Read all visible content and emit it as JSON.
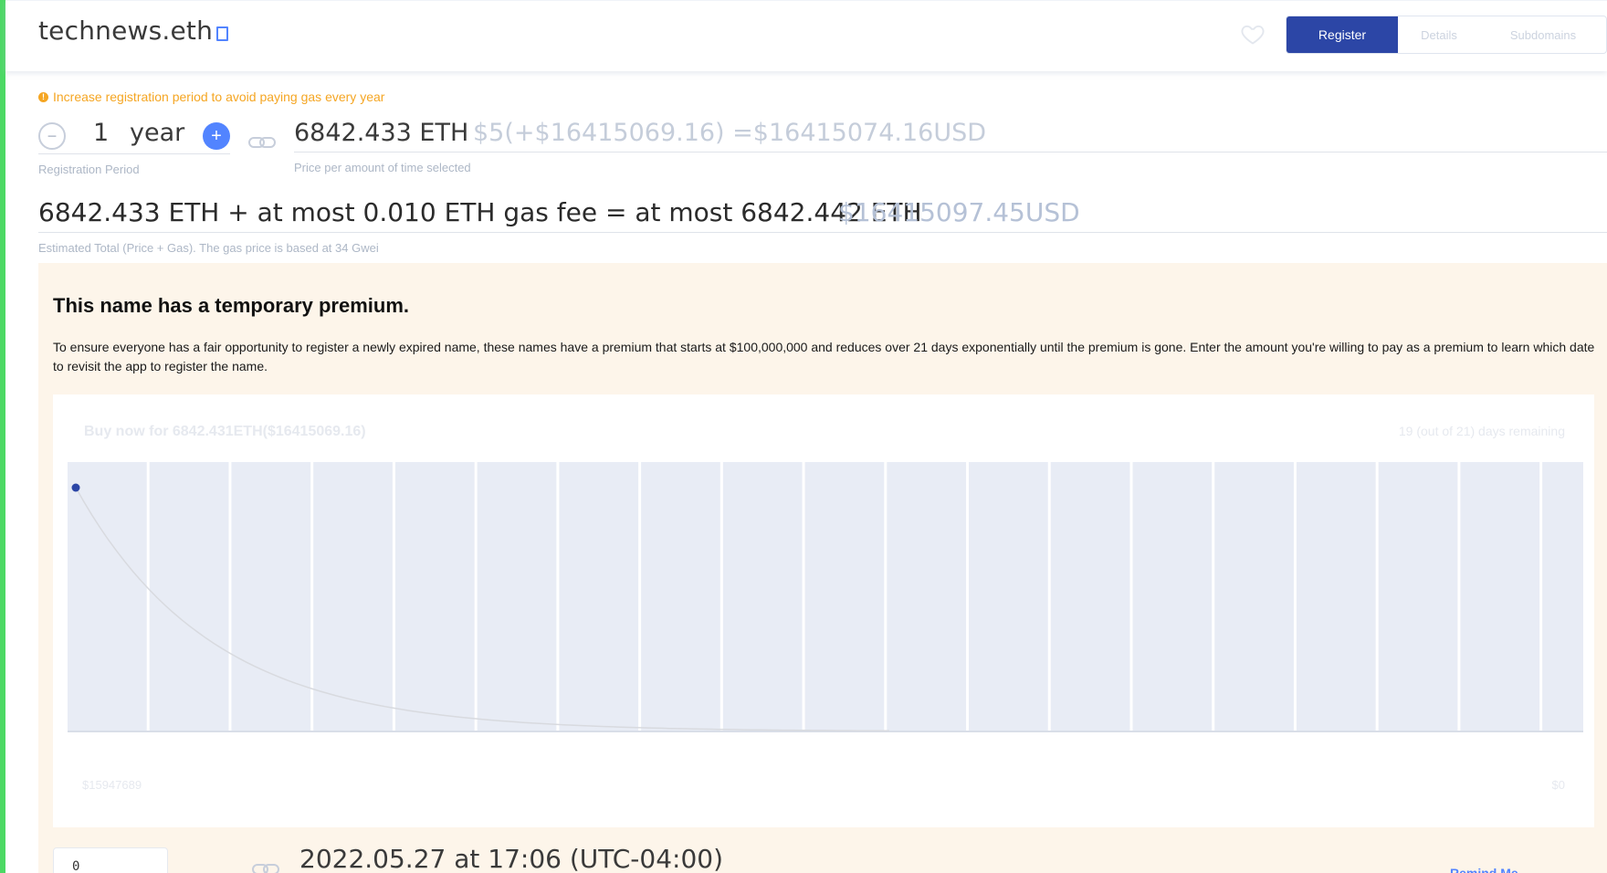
{
  "header": {
    "domain_name": "technews.eth",
    "tabs": [
      {
        "label": "Register",
        "active": true
      },
      {
        "label": "Details",
        "active": false
      },
      {
        "label": "Subdomains",
        "active": false
      }
    ]
  },
  "registration": {
    "warning": "Increase registration period to avoid paying gas every year",
    "years": "1",
    "year_unit": "year",
    "period_label": "Registration Period",
    "price_eth": "6842.433 ETH",
    "price_usd": "$5(+$16415069.16) =$16415074.16USD",
    "price_label": "Price per amount of time selected",
    "total_text": "6842.433 ETH + at most 0.010 ETH gas fee = at most 6842.442 ETH",
    "total_usd": "$16415097.45USD",
    "total_label": "Estimated Total (Price + Gas). The gas price is based at 34 Gwei"
  },
  "premium": {
    "title": "This name has a temporary premium.",
    "description": "To ensure everyone has a fair opportunity to register a newly expired name, these names have a premium that starts at $100,000,000 and reduces over 21 days exponentially until the premium is gone. Enter the amount you're willing to pay as a premium to learn which date to revisit the app to register the name.",
    "buy_now": "Buy now for 6842.431ETH($16415069.16)",
    "remaining": "19 (out of 21) days remaining",
    "start_value_label": "$15947689",
    "end_value_label": "$0",
    "input_value": "0",
    "date_text": "2022.05.27 at 17:06 (UTC-04:00)",
    "reminder_label": "Remind Me"
  },
  "colors": {
    "accent": "#5284ff",
    "active_tab": "#2c46a6",
    "warning": "#f5a623",
    "premium_bg": "#fdf5ea",
    "chart_bg": "#e8ecf5"
  }
}
